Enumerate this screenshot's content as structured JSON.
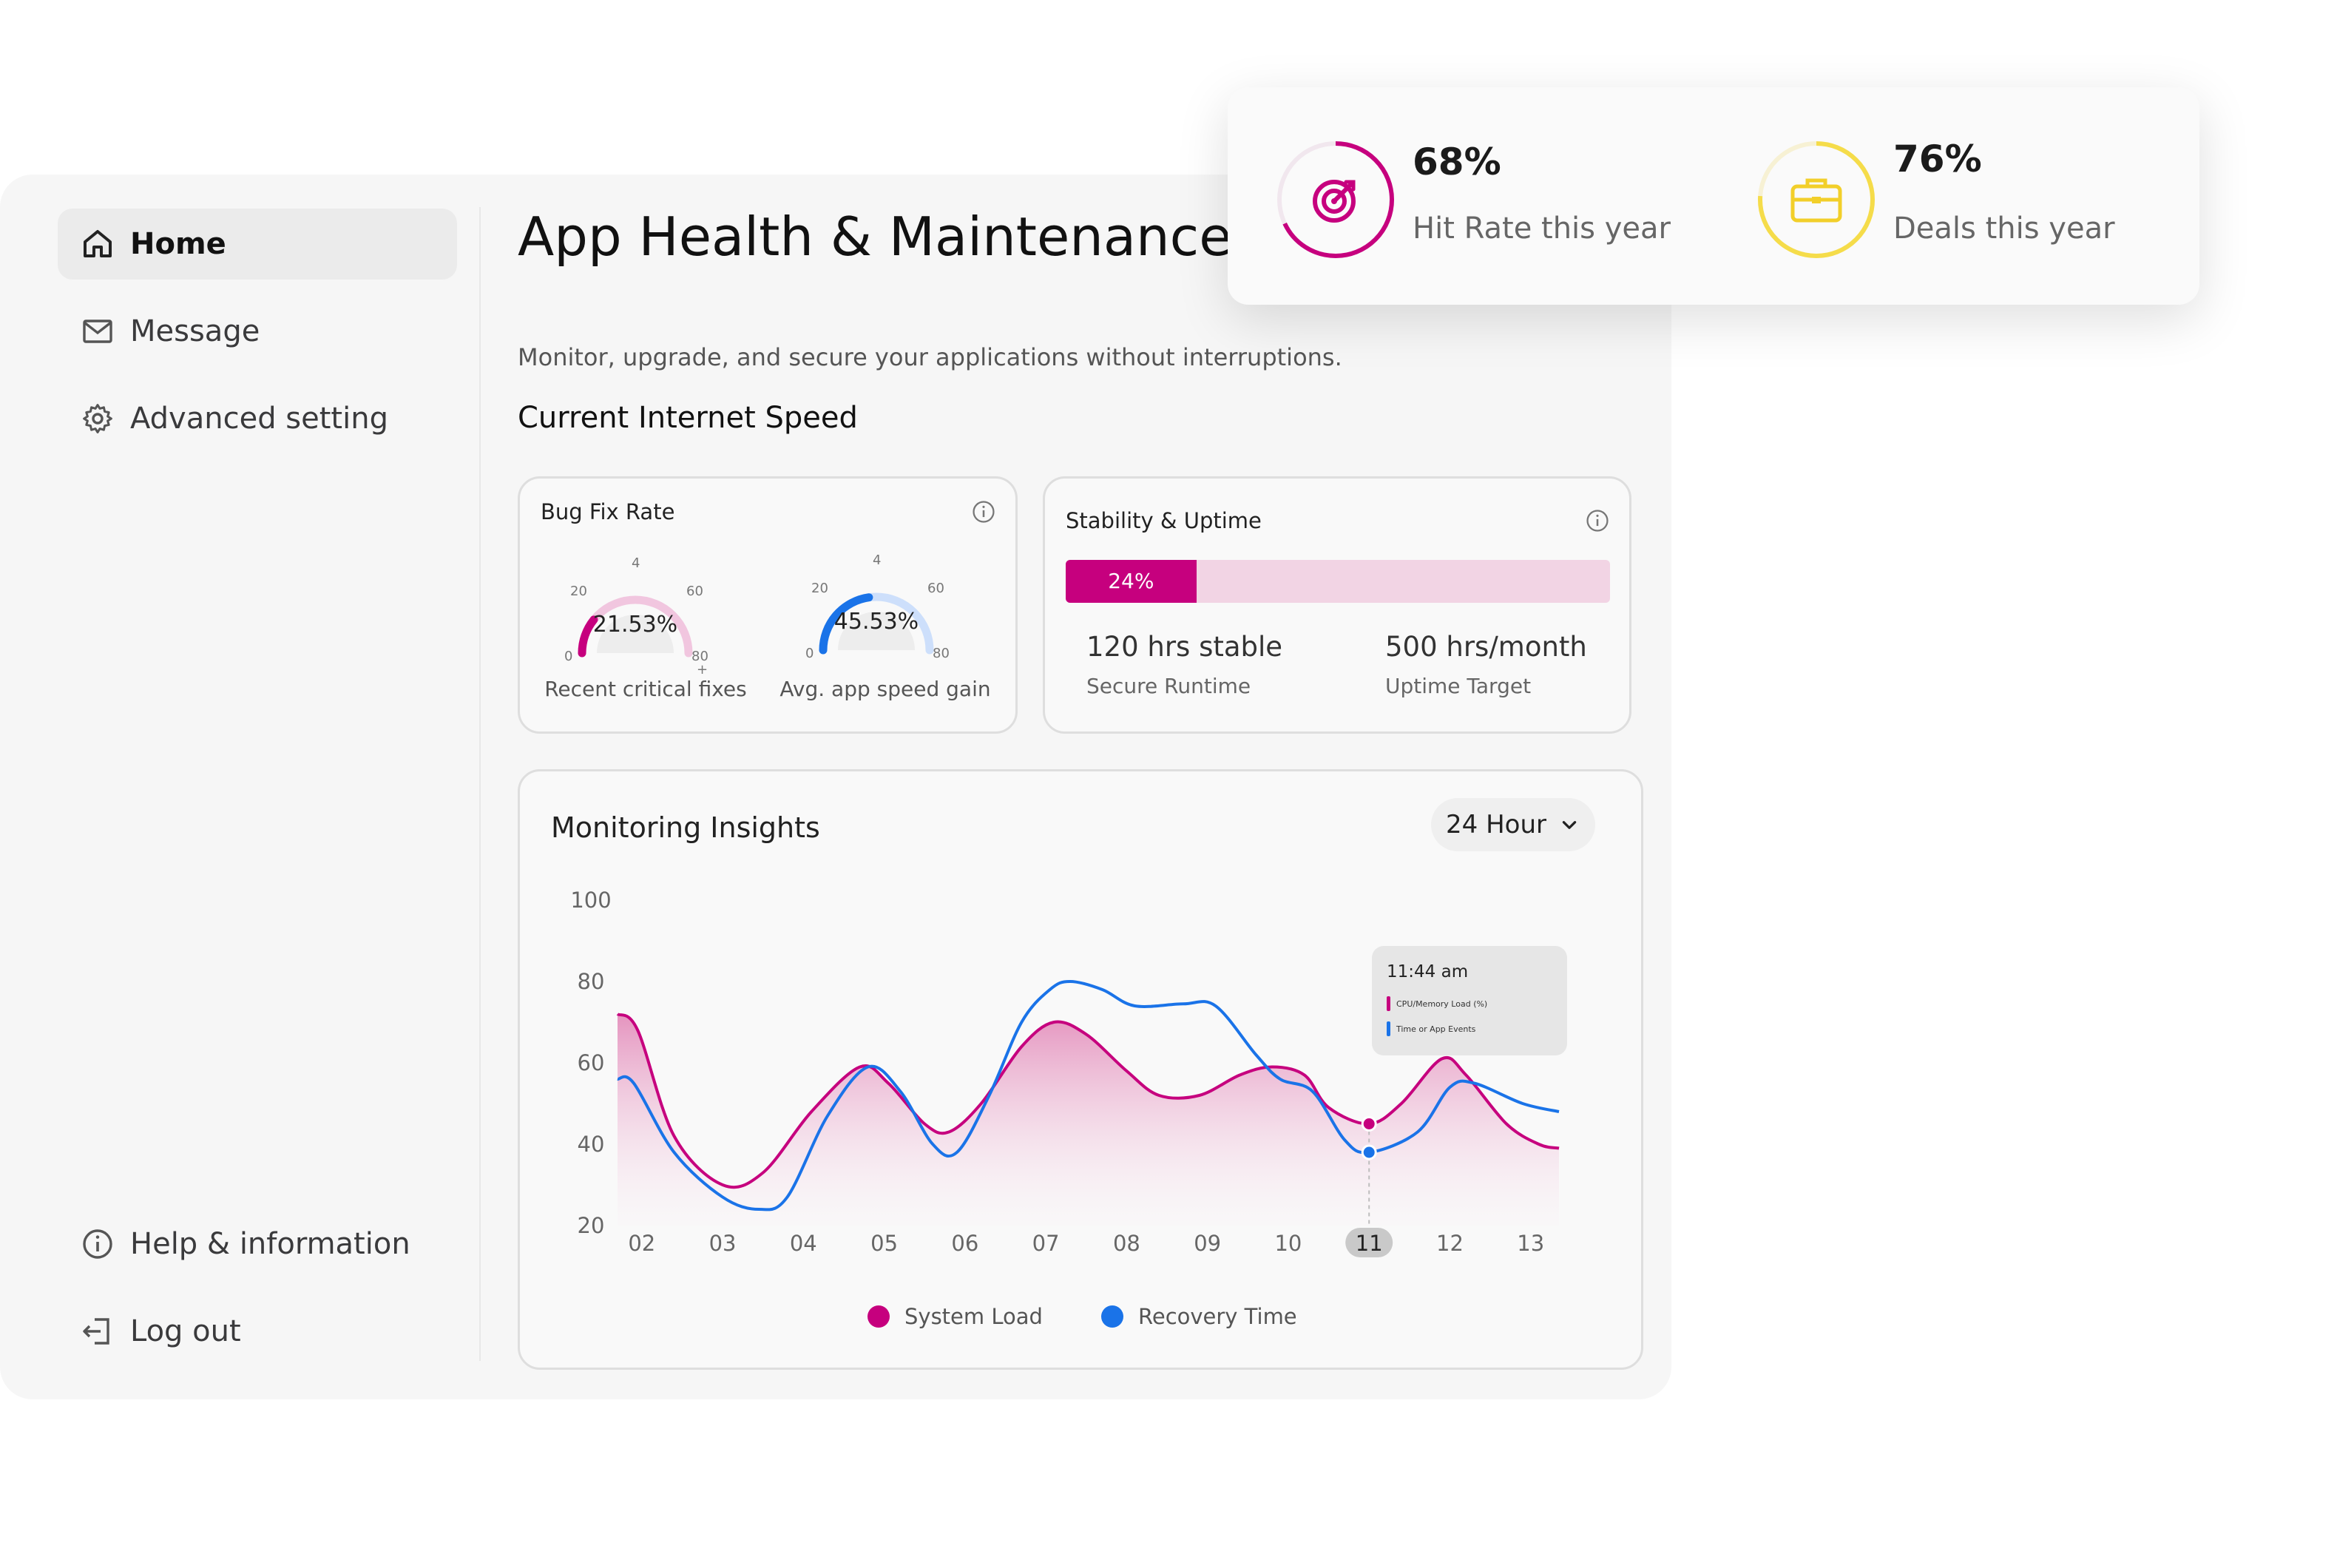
{
  "sidebar": {
    "items": [
      {
        "label": "Home",
        "icon": "home-icon"
      },
      {
        "label": "Message",
        "icon": "mail-icon"
      },
      {
        "label": "Advanced setting",
        "icon": "gear-icon"
      }
    ],
    "footer": [
      {
        "label": "Help & information",
        "icon": "info-icon"
      },
      {
        "label": "Log out",
        "icon": "logout-icon"
      }
    ]
  },
  "header": {
    "title": "App Health & Maintenance",
    "subtitle": "Monitor, upgrade, and secure your applications without interruptions.",
    "section": "Current Internet Speed"
  },
  "bug_fix": {
    "title": "Bug Fix Rate",
    "gauges": [
      {
        "value": 21.53,
        "value_text": "21.53%",
        "label": "Recent critical fixes",
        "color": "#c6007e",
        "track": "#f1c6df",
        "ticks": [
          "0",
          "20",
          "4",
          "60",
          "80",
          "+"
        ]
      },
      {
        "value": 45.53,
        "value_text": "45.53%",
        "label": "Avg. app speed gain",
        "color": "#1a73e8",
        "track": "#cddffb",
        "ticks": [
          "0",
          "20",
          "4",
          "60",
          "80"
        ]
      }
    ]
  },
  "stability": {
    "title": "Stability & Uptime",
    "progress": 24,
    "progress_text": "24%",
    "stats": [
      {
        "value": "120 hrs stable",
        "label": "Secure Runtime"
      },
      {
        "value": "500 hrs/month",
        "label": "Uptime Target"
      }
    ]
  },
  "monitoring": {
    "title": "Monitoring Insights",
    "range": "24 Hour",
    "tooltip": {
      "time": "11:44 am",
      "rows": [
        "CPU/Memory Load (%)",
        "Time or App Events"
      ]
    }
  },
  "chart_data": {
    "type": "area",
    "x": [
      "02",
      "03",
      "04",
      "05",
      "06",
      "07",
      "08",
      "09",
      "10",
      "11",
      "12",
      "13"
    ],
    "x_pos": [
      1.3,
      2.3,
      3.3,
      4.3,
      5.3,
      6.3,
      7.3,
      8.3,
      9.3,
      10.3,
      11.3,
      12.3
    ],
    "highlight": "11",
    "ylim": [
      20,
      100
    ],
    "yticks": [
      100,
      80,
      60,
      40,
      20
    ],
    "xlim": [
      1.0,
      12.65
    ],
    "series": [
      {
        "name": "System Load",
        "color": "#c6007e",
        "points": [
          [
            1.0,
            72
          ],
          [
            1.25,
            68
          ],
          [
            1.7,
            42
          ],
          [
            2.3,
            30
          ],
          [
            2.8,
            33
          ],
          [
            3.4,
            48
          ],
          [
            4.0,
            59
          ],
          [
            4.35,
            55
          ],
          [
            4.8,
            45
          ],
          [
            5.1,
            43
          ],
          [
            5.5,
            50
          ],
          [
            6.0,
            64
          ],
          [
            6.4,
            70
          ],
          [
            6.8,
            67
          ],
          [
            7.3,
            58
          ],
          [
            7.7,
            52
          ],
          [
            8.2,
            52
          ],
          [
            8.7,
            57
          ],
          [
            9.1,
            59
          ],
          [
            9.5,
            57
          ],
          [
            9.8,
            49
          ],
          [
            10.3,
            45
          ],
          [
            10.7,
            50
          ],
          [
            11.2,
            61
          ],
          [
            11.5,
            57
          ],
          [
            12.0,
            45
          ],
          [
            12.4,
            40
          ],
          [
            12.65,
            39
          ]
        ]
      },
      {
        "name": "Recovery Time",
        "color": "#1a73e8",
        "points": [
          [
            1.0,
            56
          ],
          [
            1.2,
            55
          ],
          [
            1.7,
            38
          ],
          [
            2.3,
            27
          ],
          [
            2.75,
            24
          ],
          [
            3.1,
            27
          ],
          [
            3.6,
            47
          ],
          [
            4.1,
            59
          ],
          [
            4.5,
            53
          ],
          [
            4.9,
            40
          ],
          [
            5.2,
            38
          ],
          [
            5.6,
            52
          ],
          [
            6.0,
            70
          ],
          [
            6.35,
            78
          ],
          [
            6.6,
            80
          ],
          [
            7.0,
            78
          ],
          [
            7.4,
            74
          ],
          [
            8.0,
            74.5
          ],
          [
            8.4,
            74
          ],
          [
            8.9,
            62
          ],
          [
            9.2,
            56
          ],
          [
            9.6,
            53
          ],
          [
            10.0,
            41
          ],
          [
            10.3,
            38
          ],
          [
            10.9,
            43
          ],
          [
            11.3,
            54
          ],
          [
            11.6,
            55
          ],
          [
            12.2,
            50
          ],
          [
            12.65,
            48
          ]
        ]
      }
    ],
    "markers": [
      {
        "x": 10.3,
        "y": 45,
        "series": 0
      },
      {
        "x": 10.3,
        "y": 38,
        "series": 1
      }
    ]
  },
  "floating": {
    "stats": [
      {
        "pct": "68%",
        "label": "Hit Rate this year",
        "value": 68,
        "color": "#c6007e",
        "icon": "target-icon"
      },
      {
        "pct": "76%",
        "label": "Deals this year",
        "value": 76,
        "color": "#f5dc4a",
        "icon": "briefcase-icon"
      }
    ]
  }
}
